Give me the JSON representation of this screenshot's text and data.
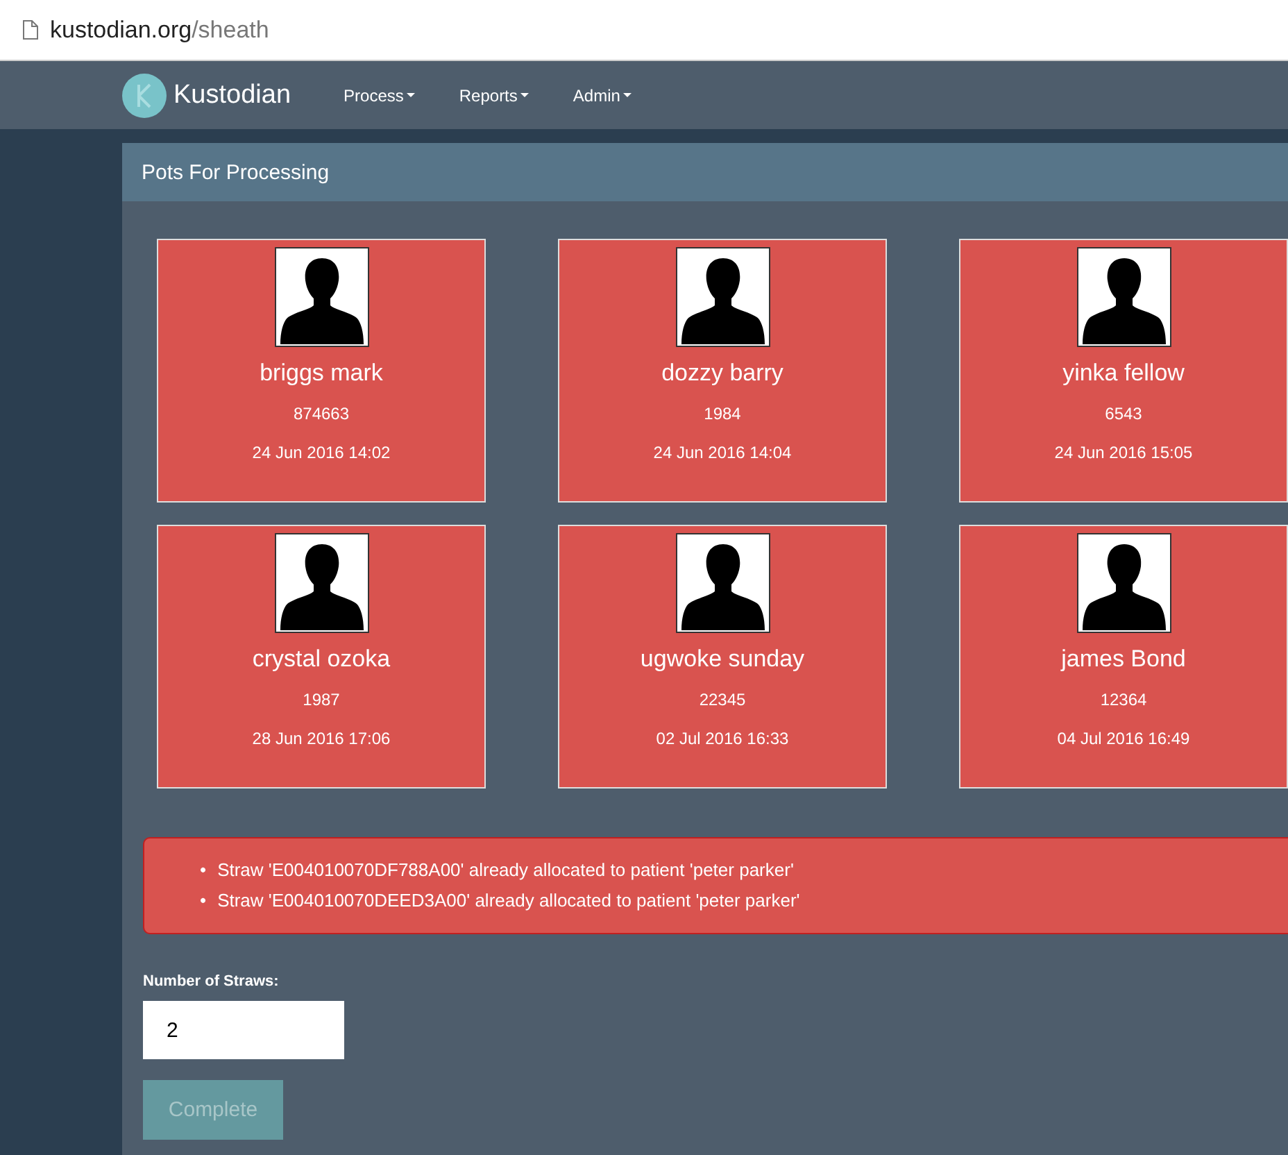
{
  "address_bar": {
    "host": "kustodian.org",
    "path": "/sheath"
  },
  "navbar": {
    "brand": "Kustodian",
    "menus": [
      {
        "label": "Process"
      },
      {
        "label": "Reports"
      },
      {
        "label": "Admin"
      }
    ]
  },
  "panel": {
    "title": "Pots For Processing",
    "patients": [
      {
        "name": "briggs mark",
        "number": "874663",
        "date": "24 Jun 2016 14:02"
      },
      {
        "name": "dozzy barry",
        "number": "1984",
        "date": "24 Jun 2016 14:04"
      },
      {
        "name": "yinka fellow",
        "number": "6543",
        "date": "24 Jun 2016 15:05"
      },
      {
        "name": "crystal ozoka",
        "number": "1987",
        "date": "28 Jun 2016 17:06"
      },
      {
        "name": "ugwoke sunday",
        "number": "22345",
        "date": "02 Jul 2016 16:33"
      },
      {
        "name": "james Bond",
        "number": "12364",
        "date": "04 Jul 2016 16:49"
      }
    ],
    "errors": [
      {
        "bullet": "•",
        "text": "Straw 'E004010070DF788A00' already allocated to patient 'peter parker'"
      },
      {
        "bullet": "•",
        "text": "Straw 'E004010070DEED3A00' already allocated to patient 'peter parker'"
      }
    ],
    "straws_field": {
      "label": "Number of Straws:",
      "value": "2"
    },
    "complete_button": {
      "label": "Complete",
      "disabled": true
    }
  }
}
